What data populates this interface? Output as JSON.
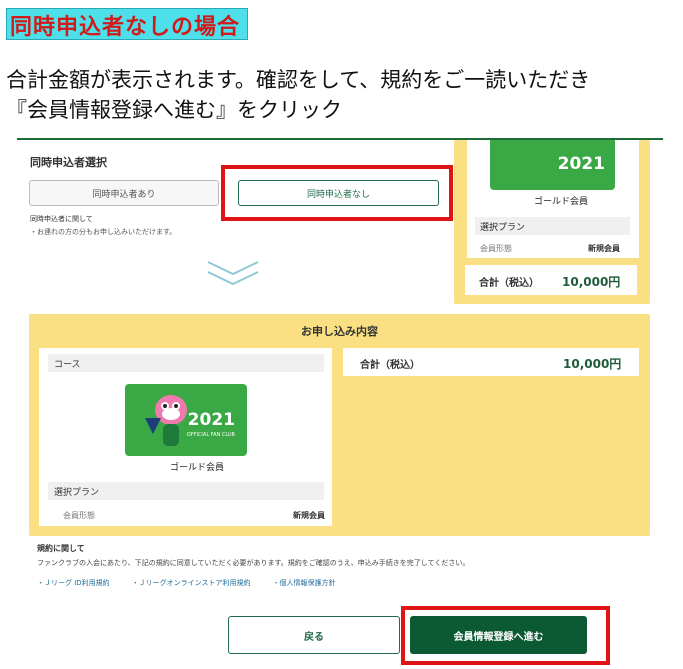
{
  "heading": "同時申込者なしの場合",
  "instructions": {
    "line1": "合計金額が表示されます。確認をして、規約をご一読いただき",
    "line2": "『会員情報登録へ進む』をクリック"
  },
  "selection": {
    "title": "同時申込者選択",
    "option_with": "同時申込者あり",
    "option_without": "同時申込者なし",
    "note_title": "同時申込者に関して",
    "note_body": "・お連れの方の分もお申し込みいただけます。"
  },
  "summary": {
    "card_year": "2021",
    "card_name": "ゴールド会員",
    "plan_label": "選択プラン",
    "member_type_label": "会員形態",
    "member_type_value": "新規会員",
    "total_label": "合計（税込）",
    "total_value": "10,000円"
  },
  "order": {
    "title": "お申し込み内容",
    "course_label": "コース",
    "card_year": "2021",
    "card_sub": "OFFICIAL FAN CLUB",
    "card_name": "ゴールド会員",
    "plan_label": "選択プラン",
    "member_type_label": "会員形態",
    "member_type_value": "新規会員",
    "total_label": "合計（税込）",
    "total_value": "10,000円"
  },
  "terms": {
    "title": "規約に関して",
    "body": "ファンクラブの入会にあたり、下記の規約に同意していただく必要があります。規約をご確認のうえ、申込み手続きを完了してください。",
    "links": [
      "・Ｊリーグ ID利用規約",
      "・Ｊリーグオンラインストア利用規約",
      "・個人情報保護方針"
    ]
  },
  "buttons": {
    "back": "戻る",
    "next": "会員情報登録へ進む"
  },
  "colors": {
    "accent_green": "#0c5a34",
    "panel_yellow": "#fae082",
    "highlight_red": "#e01414",
    "heading_bg": "#4de0ea"
  }
}
